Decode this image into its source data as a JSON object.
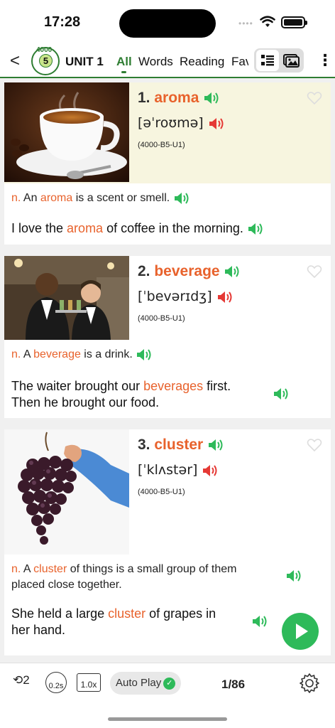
{
  "status_bar": {
    "time": "17:28"
  },
  "nav": {
    "logo_number": "5",
    "logo_text": "4000",
    "unit_title": "UNIT 1",
    "tabs": [
      {
        "label": "All",
        "active": true
      },
      {
        "label": "Words",
        "active": false
      },
      {
        "label": "Reading",
        "active": false
      },
      {
        "label": "Fav",
        "active": false
      }
    ],
    "view_toggle": {
      "options": [
        "list-icon",
        "image-icon"
      ],
      "selected": "list-icon"
    }
  },
  "words": [
    {
      "number": "1.",
      "word": "aroma",
      "phonetic": "[əˈroʊmə]",
      "code": "(4000-B5-U1)",
      "image": "coffee cup",
      "definition": {
        "pos": "n.",
        "before": " An ",
        "highlight": "aroma",
        "after": " is a scent or smell."
      },
      "example": {
        "before": "I love the ",
        "highlight": "aroma",
        "after": " of coffee in the morning."
      }
    },
    {
      "number": "2.",
      "word": "beverage",
      "phonetic": "[ˈbevərɪdʒ]",
      "code": "(4000-B5-U1)",
      "image": "waiters with drinks",
      "definition": {
        "pos": "n.",
        "before": " A ",
        "highlight": "beverage",
        "after": " is a drink."
      },
      "example": {
        "line1_before": "The waiter brought our ",
        "highlight": "beverages",
        "line1_after": " first.",
        "line2": "Then he brought our food."
      }
    },
    {
      "number": "3.",
      "word": "cluster",
      "phonetic": "[ˈklʌstər]",
      "code": "(4000-B5-U1)",
      "image": "bunch of grapes",
      "definition": {
        "pos": "n.",
        "before": " A ",
        "highlight": "cluster",
        "after": " of things is a small group of them",
        "line2": "placed close together."
      },
      "example": {
        "line1_before": "She held a large ",
        "highlight": "cluster",
        "line1_after": " of grapes in",
        "line2": "her hand."
      }
    }
  ],
  "bottom_bar": {
    "repeat_count": "2",
    "interval": "0.2s",
    "speed": "1.0x",
    "auto_play_label": "Auto Play",
    "auto_play_on": true,
    "page_indicator": "1/86"
  },
  "colors": {
    "accent_green": "#2e7d32",
    "highlight_orange": "#e8622c",
    "speaker_green": "#2eba5a",
    "speaker_red": "#e53935"
  }
}
